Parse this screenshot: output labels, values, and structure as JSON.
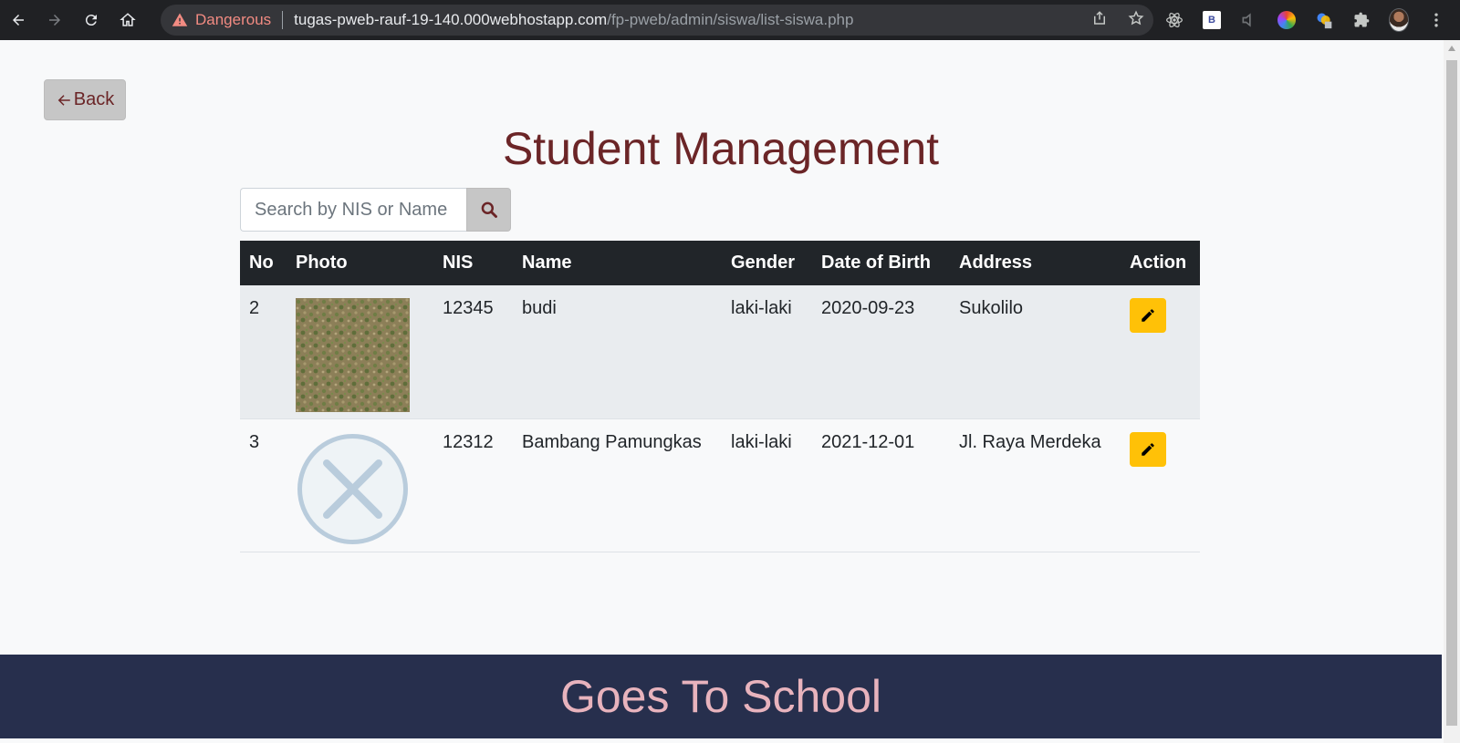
{
  "browser": {
    "security_label": "Dangerous",
    "url_host": "tugas-pweb-rauf-19-140.000webhostapp.com",
    "url_path": "/fp-pweb/admin/siswa/list-siswa.php",
    "extension_b_label": "B"
  },
  "page": {
    "back_label": "Back",
    "title": "Student Management",
    "search_placeholder": "Search by NIS or Name"
  },
  "table": {
    "headers": [
      "No",
      "Photo",
      "NIS",
      "Name",
      "Gender",
      "Date of Birth",
      "Address",
      "Action"
    ],
    "rows": [
      {
        "no": "2",
        "photo": "grass-photo",
        "nis": "12345",
        "name": "budi",
        "gender": "laki-laki",
        "dob": "2020-09-23",
        "address": "Sukolilo"
      },
      {
        "no": "3",
        "photo": "missing-image-placeholder",
        "nis": "12312",
        "name": "Bambang Pamungkas",
        "gender": "laki-laki",
        "dob": "2021-12-01",
        "address": "Jl. Raya Merdeka"
      }
    ]
  },
  "footer": {
    "text": "Goes To School"
  },
  "colors": {
    "accent": "#6b2527",
    "footer_bg": "#272f4d",
    "footer_text": "#e8b3bd",
    "edit_button": "#ffc107",
    "danger": "#f28b82"
  }
}
